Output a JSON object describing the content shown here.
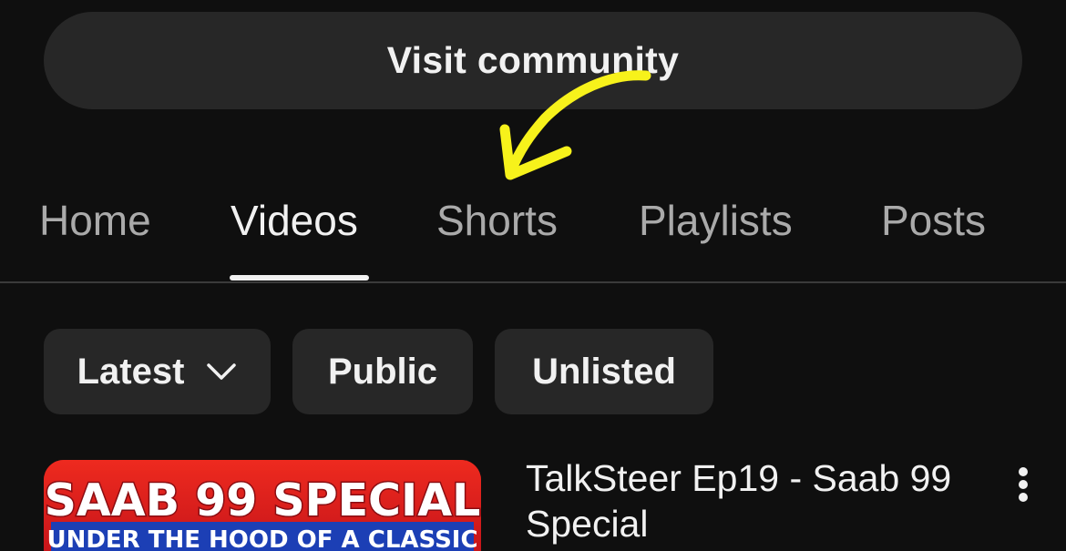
{
  "community": {
    "label": "Visit community"
  },
  "tabs": [
    {
      "label": "Home",
      "active": false
    },
    {
      "label": "Videos",
      "active": true
    },
    {
      "label": "Shorts",
      "active": false
    },
    {
      "label": "Playlists",
      "active": false
    },
    {
      "label": "Posts",
      "active": false
    }
  ],
  "filters": {
    "sort": {
      "label": "Latest",
      "icon": "chevron-down-icon"
    },
    "chips": [
      {
        "label": "Public"
      },
      {
        "label": "Unlisted"
      }
    ]
  },
  "video": {
    "title": "TalkSteer Ep19 - Saab 99 Special",
    "thumbnail_text": "SAAB 99 SPECIAL",
    "thumbnail_subtext": "UNDER THE HOOD OF A CLASSIC",
    "menu_icon": "more-vertical-icon"
  },
  "annotation": {
    "icon": "arrow-annotation-icon",
    "color": "#f7f21b"
  },
  "colors": {
    "background": "#0f0f0f",
    "surface": "#272727",
    "text": "#f1f1f1",
    "text_muted": "#aaaaaa",
    "thumbnail_red": "#d61b1b"
  }
}
